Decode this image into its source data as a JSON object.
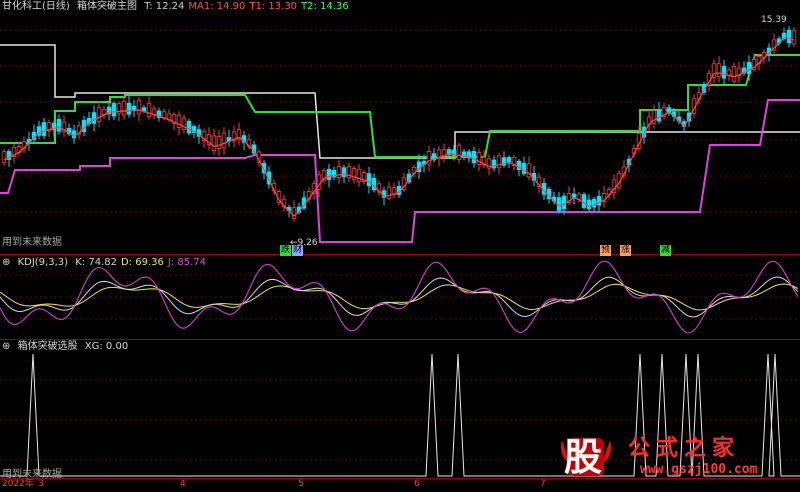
{
  "main_panel": {
    "title": "甘化科工(日线)",
    "indicator": "箱体突破主图",
    "values": [
      {
        "label": "T: 12.24",
        "color": "#cfcfcf"
      },
      {
        "label": "MA1: 14.90",
        "color": "#ff5050"
      },
      {
        "label": "T1: 13.30",
        "color": "#ff5050"
      },
      {
        "label": "T2: 14.36",
        "color": "#3cff3c"
      }
    ],
    "high_label": "15.39",
    "low_label": "9.26",
    "future_data_note": "用到未来数据",
    "signals": [
      {
        "text": "跌",
        "bg": "#2ee02e"
      },
      {
        "text": "财",
        "bg": "#8aa8ff"
      },
      {
        "text": "预",
        "bg": "#ff9f5a"
      },
      {
        "text": "涨",
        "bg": "#ff9f5a"
      },
      {
        "text": "减",
        "bg": "#2ee02e"
      }
    ]
  },
  "kdj_panel": {
    "indicator": "KDJ(9,3,3)",
    "values": [
      {
        "label": "K: 74.82",
        "color": "#d8d8d8"
      },
      {
        "label": "D: 69.36",
        "color": "#e8e84a"
      },
      {
        "label": "J: 85.74",
        "color": "#d050d0"
      }
    ]
  },
  "xg_panel": {
    "indicator": "箱体突破选股",
    "values": [
      {
        "label": "XG: 0.00",
        "color": "#d8d8d8"
      }
    ],
    "future_data_note": "用到未来数据"
  },
  "time_axis": {
    "labels": [
      "2022年",
      "3",
      "4",
      "5",
      "6",
      "7"
    ]
  },
  "watermark": {
    "logo_char": "股",
    "title": "公式之家",
    "url": "www.gszj100.com"
  },
  "colors": {
    "up": "#ff3c3c",
    "down": "#00e4ff",
    "box_white": "#e6e6e6",
    "box_green": "#30e030",
    "box_magenta": "#e040e0",
    "grid": "#7a0000"
  }
}
